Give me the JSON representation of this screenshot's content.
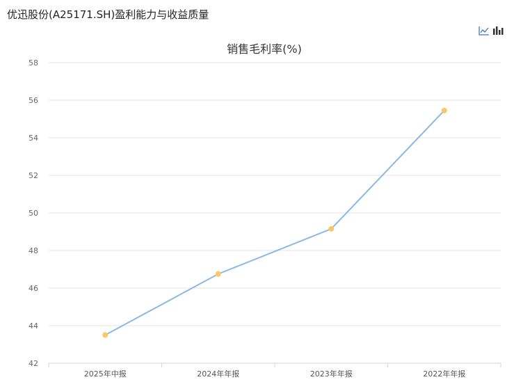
{
  "page": {
    "title": "优迅股份(A25171.SH)盈利能力与收益质量"
  },
  "toolbox": {
    "line_icon": "line-chart-icon",
    "bar_icon": "bar-chart-icon"
  },
  "colors": {
    "line": "#8ab8e6",
    "point": "#f8c86a",
    "grid": "#e6e6e6",
    "axis": "#cfd6e4"
  },
  "chart_data": {
    "type": "line",
    "title": "销售毛利率(%)",
    "categories": [
      "2025年中报",
      "2024年年报",
      "2023年年报",
      "2022年年报"
    ],
    "series": [
      {
        "values": [
          43.5,
          46.75,
          49.15,
          55.45
        ]
      }
    ],
    "ylim": [
      42,
      58
    ],
    "yticks": [
      42,
      44,
      46,
      48,
      50,
      52,
      54,
      56,
      58
    ],
    "grid": true,
    "legend": "none"
  }
}
